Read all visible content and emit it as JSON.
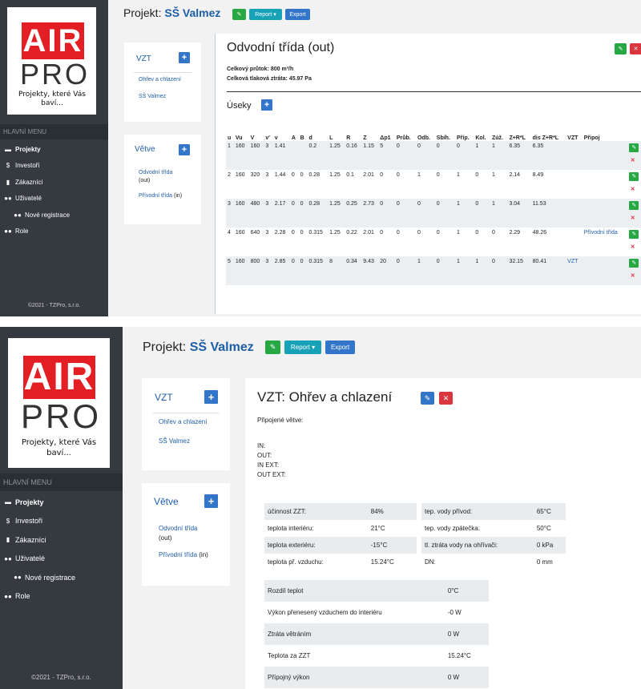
{
  "logo": {
    "air": "AIR",
    "pro": "PRO",
    "tagline": "Projekty, které Vás baví..."
  },
  "menu": {
    "heading": "HLAVNÍ MENU",
    "items": [
      {
        "icon": "folder-icon",
        "glyph": "▬",
        "label": "Projekty",
        "active": true
      },
      {
        "icon": "dollar-icon",
        "glyph": "$",
        "label": "Investoři"
      },
      {
        "icon": "building-icon",
        "glyph": "▮",
        "label": "Zákazníci"
      },
      {
        "icon": "users-icon",
        "glyph": "●●",
        "label": "Uživatelé"
      },
      {
        "icon": "users-icon",
        "glyph": "●●",
        "label": "Nové registrace",
        "sub": true
      },
      {
        "icon": "users-icon",
        "glyph": "●●",
        "label": "Role"
      }
    ],
    "copyright": "©2021 - TZPro, s.r.o."
  },
  "project": {
    "prefix": "Projekt:",
    "name": "SŠ Valmez",
    "report_label": "Report ▾",
    "export_label": "Export"
  },
  "vzt_card": {
    "title": "VZT",
    "links": [
      "Ohřev a chlazení",
      "SŠ Valmez"
    ]
  },
  "vetve_card": {
    "title": "Větve",
    "links": [
      {
        "name": "Odvodní třída",
        "dir": "(out)"
      },
      {
        "name": "Přívodní třída",
        "dir": "(in)"
      }
    ]
  },
  "screen1": {
    "title": "Odvodní třída (out)",
    "summary1": "Celkový průtok: 800 m³/h",
    "summary2": "Celková tlaková ztráta: 45.97 Pa",
    "sections_title": "Úseky",
    "columns": [
      "u",
      "Vu",
      "V",
      "v'",
      "v",
      "A",
      "B",
      "d",
      "L",
      "R",
      "Z",
      "Δp1",
      "Průb.",
      "Odb.",
      "Sbíh.",
      "Příp.",
      "Kol.",
      "Zúž.",
      "Z+R*L",
      "dis Z+R*L",
      "VZT",
      "Připoj"
    ],
    "rows": [
      [
        "1",
        "160",
        "160",
        "3",
        "1.41",
        "",
        "",
        "0.2",
        "1.25",
        "0.16",
        "1.15",
        "5",
        "0",
        "0",
        "0",
        "0",
        "1",
        "1",
        "6.35",
        "6.35",
        "",
        ""
      ],
      [
        "2",
        "160",
        "320",
        "3",
        "1.44",
        "0",
        "0",
        "0.28",
        "1.25",
        "0.1",
        "2.01",
        "0",
        "0",
        "1",
        "0",
        "1",
        "0",
        "1",
        "2.14",
        "8.49",
        "",
        ""
      ],
      [
        "3",
        "160",
        "480",
        "3",
        "2.17",
        "0",
        "0",
        "0.28",
        "1.25",
        "0.25",
        "2.73",
        "0",
        "0",
        "0",
        "0",
        "1",
        "0",
        "1",
        "3.04",
        "11.53",
        "",
        ""
      ],
      [
        "4",
        "160",
        "640",
        "3",
        "2.28",
        "0",
        "0",
        "0.315",
        "1.25",
        "0.22",
        "2.01",
        "0",
        "0",
        "0",
        "0",
        "1",
        "0",
        "0",
        "2.29",
        "48.26",
        "",
        "Přívodní třída"
      ],
      [
        "5",
        "160",
        "800",
        "3",
        "2.85",
        "0",
        "0",
        "0.315",
        "8",
        "0.34",
        "9.43",
        "20",
        "0",
        "1",
        "0",
        "1",
        "1",
        "0",
        "32.15",
        "80.41",
        "VZT",
        ""
      ]
    ]
  },
  "screen2": {
    "title": "VZT: Ohřev a chlazení",
    "connected": "Připojené větve:",
    "ports": [
      "IN:",
      "OUT:",
      "IN EXT:",
      "OUT EXT:"
    ],
    "params_left": [
      [
        "účinnost ZZT:",
        "84%"
      ],
      [
        "teplota interiéru:",
        "21°C"
      ],
      [
        "teplota exteriéru:",
        "-15°C"
      ],
      [
        "teplota př. vzduchu:",
        "15.24°C"
      ]
    ],
    "params_right": [
      [
        "tep. vody přívod:",
        "65°C"
      ],
      [
        "tep. vody zpátečka:",
        "50°C"
      ],
      [
        "tl. ztráta vody na ohřívači:",
        "0 kPa"
      ],
      [
        "DN:",
        "0 mm"
      ]
    ],
    "results": [
      [
        "Rozdíl teplot",
        "0°C"
      ],
      [
        "Výkon přenesený vzduchem do interiéru",
        "-0 W"
      ],
      [
        "Ztráta větráním",
        "0 W"
      ],
      [
        "Teplota za ZZT",
        "15.24°C"
      ],
      [
        "Přípojný výkon",
        "0 W"
      ]
    ]
  },
  "colors": {
    "sidebar": "#343a40",
    "link": "#1e5ea8",
    "green": "#28a745",
    "red": "#d9363e",
    "blue": "#3275c9",
    "teal": "#17a2b8",
    "logo_red": "#e31e24"
  }
}
